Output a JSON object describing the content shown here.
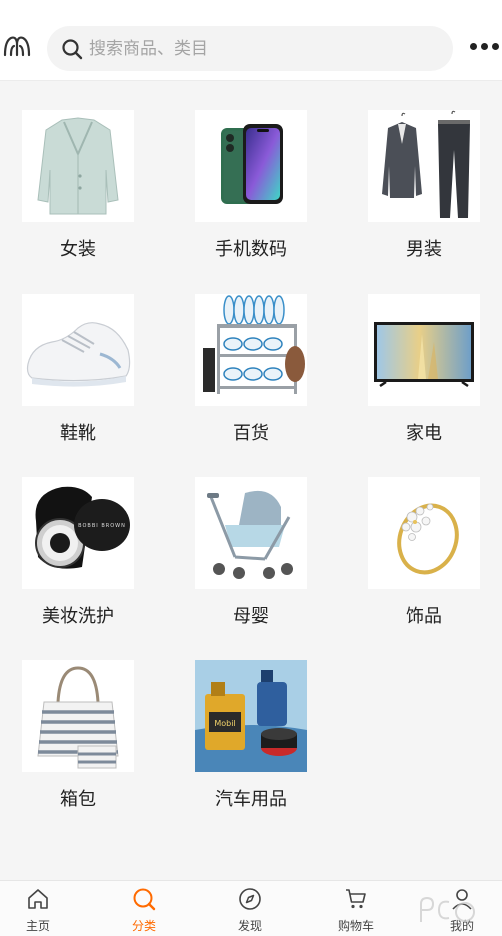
{
  "header": {
    "search_placeholder": "搜索商品、类目",
    "left_icon": "logo-icon",
    "right_icon": "more-icon"
  },
  "categories": [
    {
      "label": "女装",
      "icon": "womens-blazer"
    },
    {
      "label": "手机数码",
      "icon": "smartphone"
    },
    {
      "label": "男装",
      "icon": "mens-suit"
    },
    {
      "label": "鞋靴",
      "icon": "sneaker"
    },
    {
      "label": "百货",
      "icon": "dish-rack"
    },
    {
      "label": "家电",
      "icon": "television"
    },
    {
      "label": "美妆洗护",
      "icon": "cosmetic-jar"
    },
    {
      "label": "母婴",
      "icon": "stroller"
    },
    {
      "label": "饰品",
      "icon": "ring"
    },
    {
      "label": "箱包",
      "icon": "tote-bag"
    },
    {
      "label": "汽车用品",
      "icon": "car-oil"
    }
  ],
  "tabbar": {
    "tabs": [
      {
        "label": "主页",
        "icon": "home-icon",
        "active": false
      },
      {
        "label": "分类",
        "icon": "category-icon",
        "active": true
      },
      {
        "label": "发现",
        "icon": "compass-icon",
        "active": false
      },
      {
        "label": "购物车",
        "icon": "cart-icon",
        "active": false
      },
      {
        "label": "我的",
        "icon": "user-icon",
        "active": false
      }
    ]
  },
  "colors": {
    "accent": "#ff6a00",
    "background": "#f5f5f5",
    "text": "#222222"
  }
}
